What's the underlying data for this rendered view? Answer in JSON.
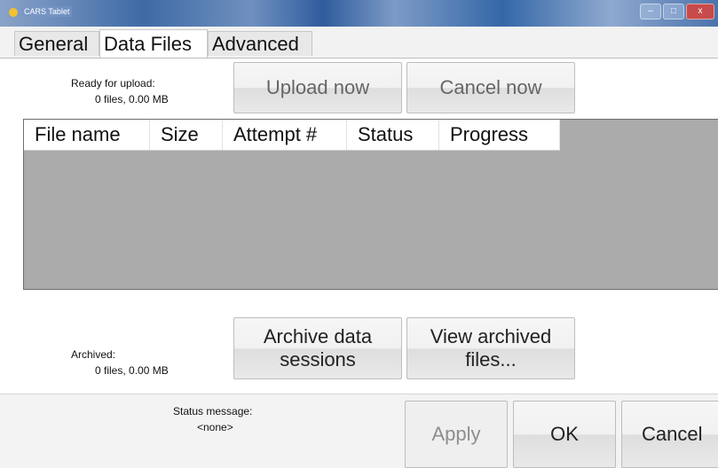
{
  "window": {
    "title": "CARS Tablet",
    "minimize": "–",
    "maximize": "□",
    "close": "x"
  },
  "tabs": [
    {
      "label": "General"
    },
    {
      "label": "Data Files"
    },
    {
      "label": "Advanced"
    }
  ],
  "upload": {
    "ready_label": "Ready for upload:",
    "ready_count": "0 files, 0.00 MB",
    "upload_button": "Upload now",
    "cancel_button": "Cancel now"
  },
  "table": {
    "columns": [
      "File name",
      "Size",
      "Attempt #",
      "Status",
      "Progress"
    ],
    "rows": []
  },
  "archive": {
    "label": "Archived:",
    "count": "0 files, 0.00 MB",
    "archive_button": "Archive data sessions",
    "view_button": "View archived files..."
  },
  "status": {
    "label": "Status message:",
    "value": "<none>"
  },
  "footer": {
    "apply": "Apply",
    "ok": "OK",
    "cancel": "Cancel"
  }
}
